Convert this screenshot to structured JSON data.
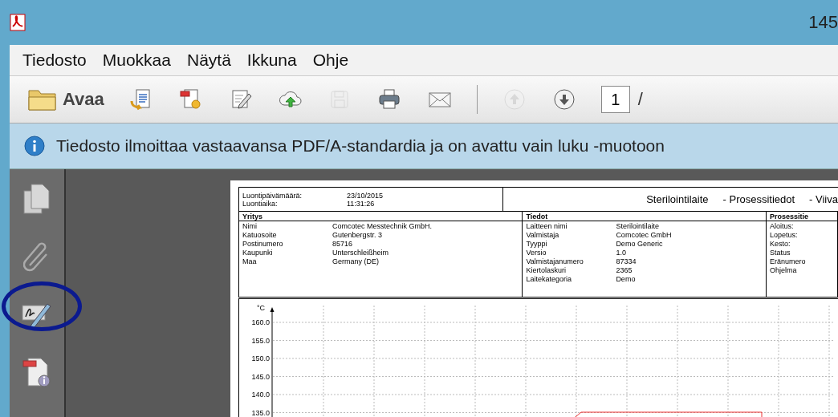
{
  "window": {
    "title": "145"
  },
  "menu": [
    "Tiedosto",
    "Muokkaa",
    "Näytä",
    "Ikkuna",
    "Ohje"
  ],
  "toolbar": {
    "open_label": "Avaa",
    "tools": [
      {
        "kind": "export",
        "disabled": false
      },
      {
        "kind": "create",
        "disabled": false
      },
      {
        "kind": "edit",
        "disabled": false
      },
      {
        "kind": "upload",
        "disabled": false
      },
      {
        "kind": "save",
        "disabled": true
      },
      {
        "kind": "print",
        "disabled": false
      },
      {
        "kind": "mail",
        "disabled": false
      },
      {
        "kind": "prev",
        "disabled": true
      },
      {
        "kind": "next",
        "disabled": false
      }
    ],
    "page_number": "1",
    "page_total": "/"
  },
  "info_bar": {
    "message": "Tiedosto ilmoittaa vastaavansa PDF/A-standardia ja on avattu vain luku -muotoon"
  },
  "sidebar": {
    "items": [
      {
        "kind": "pages"
      },
      {
        "kind": "attachments"
      },
      {
        "kind": "signatures"
      },
      {
        "kind": "info"
      }
    ]
  },
  "document": {
    "created": [
      {
        "label": "Luontipäivämäärä:",
        "value": "23/10/2015"
      },
      {
        "label": "Luontiaika:",
        "value": "11:31:26"
      }
    ],
    "title_parts": [
      "Sterilointilaite",
      "- Prosessitiedot",
      "- Viiva"
    ],
    "sections": [
      {
        "heading": "Yritys",
        "rows": [
          {
            "label": "Nimi",
            "value": "Comcotec Messtechnik GmbH."
          },
          {
            "label": "Katuosoite",
            "value": "Gutenbergstr. 3"
          },
          {
            "label": "Postinumero",
            "value": "85716"
          },
          {
            "label": "Kaupunki",
            "value": "Unterschleißheim"
          },
          {
            "label": "Maa",
            "value": "Germany (DE)"
          }
        ]
      },
      {
        "heading": "Tiedot",
        "rows": [
          {
            "label": "Laitteen nimi",
            "value": "Sterilointilaite"
          },
          {
            "label": "Valmistaja",
            "value": "Comcotec GmbH"
          },
          {
            "label": "Tyyppi",
            "value": "Demo Generic"
          },
          {
            "label": "Versio",
            "value": "1.0"
          },
          {
            "label": "Valmistajanumero",
            "value": "87334"
          },
          {
            "label": "Kiertolaskuri",
            "value": "2365"
          },
          {
            "label": "Laitekategoria",
            "value": "Demo"
          }
        ]
      },
      {
        "heading": "Prosessitie",
        "rows": [
          {
            "label": "Aloitus:"
          },
          {
            "label": "Lopetus:"
          },
          {
            "label": "Kesto:"
          },
          {
            "label": "Status"
          },
          {
            "label": "Eränumero"
          },
          {
            "label": "Ohjelma"
          }
        ]
      }
    ],
    "chart": {
      "unit": "°C",
      "y_labels": [
        "160.0",
        "155.0",
        "150.0",
        "145.0",
        "140.0",
        "135.0"
      ]
    }
  }
}
